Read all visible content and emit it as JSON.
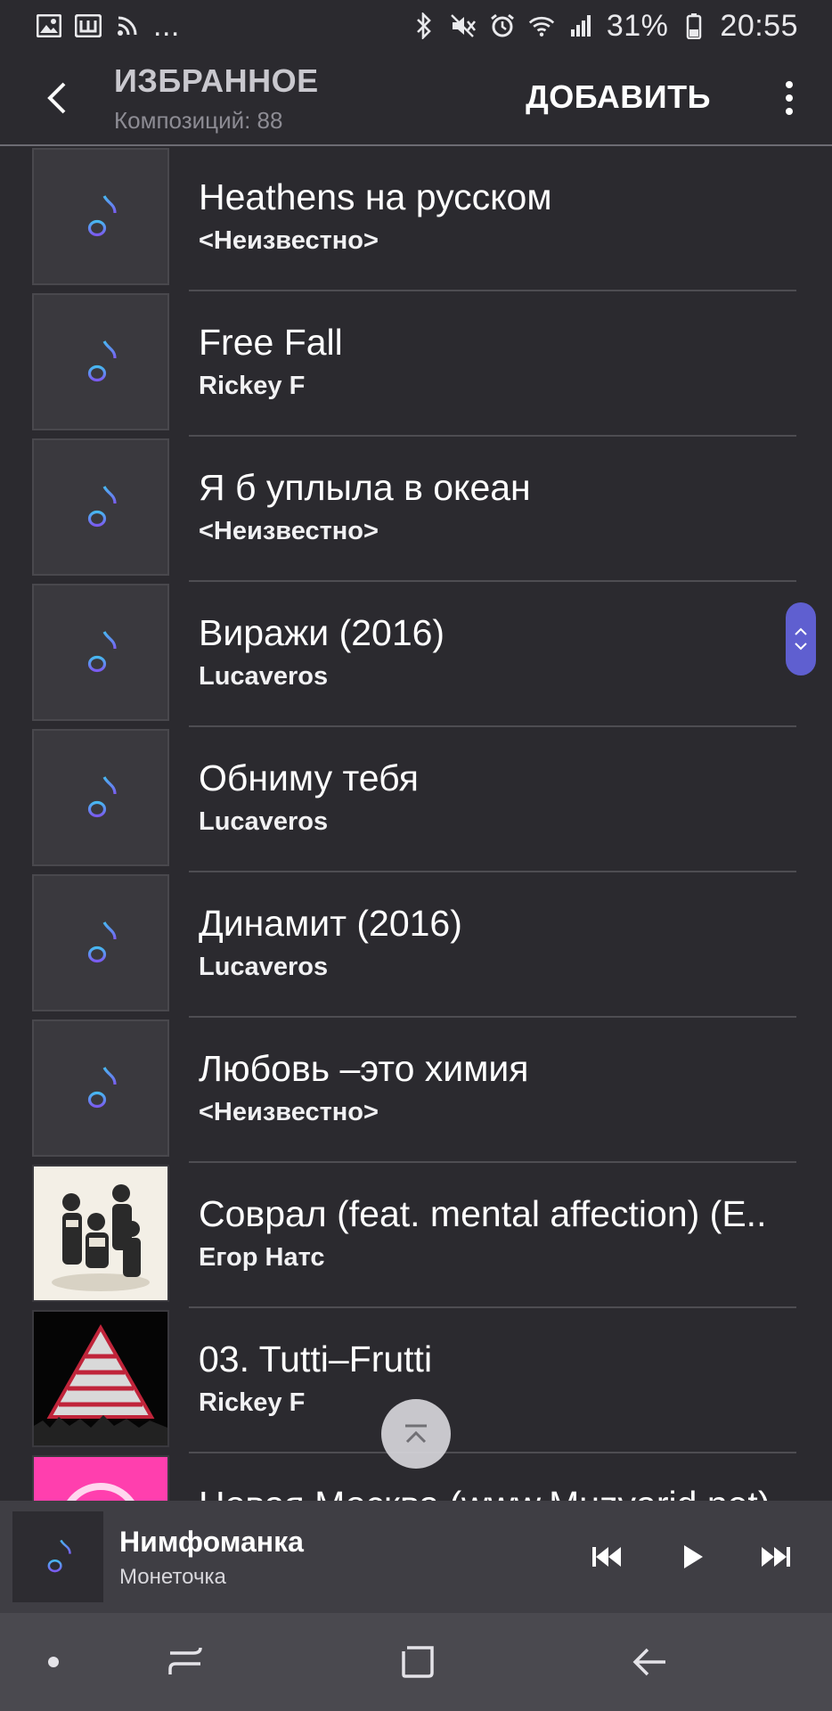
{
  "status_bar": {
    "left_icons": [
      "gallery-icon",
      "w-app-icon",
      "rss-icon"
    ],
    "more_notifications": "...",
    "right_icons": [
      "bluetooth-icon",
      "mute-icon",
      "alarm-icon",
      "wifi-icon",
      "signal-icon",
      "battery-icon"
    ],
    "battery": "31%",
    "time": "20:55"
  },
  "header": {
    "title": "ИЗБРАННОЕ",
    "subtitle": "Композиций: 88",
    "add_label": "ДОБАВИТЬ",
    "back_icon": "chevron-left-icon",
    "more_icon": "more-vertical-icon"
  },
  "tracks": [
    {
      "title": "Heathens на русском",
      "artist": "<Неизвестно>",
      "art": "note"
    },
    {
      "title": "Free Fall",
      "artist": "Rickey F",
      "art": "note"
    },
    {
      "title": "Я б уплыла в океан",
      "artist": "<Неизвестно>",
      "art": "note"
    },
    {
      "title": "Виражи (2016)",
      "artist": "Lucaveros",
      "art": "note"
    },
    {
      "title": "Обниму тебя",
      "artist": "Lucaveros",
      "art": "note"
    },
    {
      "title": "Динамит (2016)",
      "artist": "Lucaveros",
      "art": "note"
    },
    {
      "title": "Любовь –это химия",
      "artist": "<Неизвестно>",
      "art": "note"
    },
    {
      "title": "Соврал (feat. mental affection) (E..",
      "artist": "Егор Натс",
      "art": "photo-group"
    },
    {
      "title": "03. Tutti–Frutti",
      "artist": "Rickey F",
      "art": "triangle"
    },
    {
      "title": "Новая Москва (www.Muzvarid.net)",
      "artist": "",
      "art": "pink"
    }
  ],
  "now_playing": {
    "title": "Нимфоманка",
    "artist": "Монеточка"
  },
  "colors": {
    "background": "#2b2a2f",
    "note_gradient_start": "#47b8f0",
    "note_gradient_end": "#7b5bf0",
    "scroller": "#5f5fd0"
  }
}
